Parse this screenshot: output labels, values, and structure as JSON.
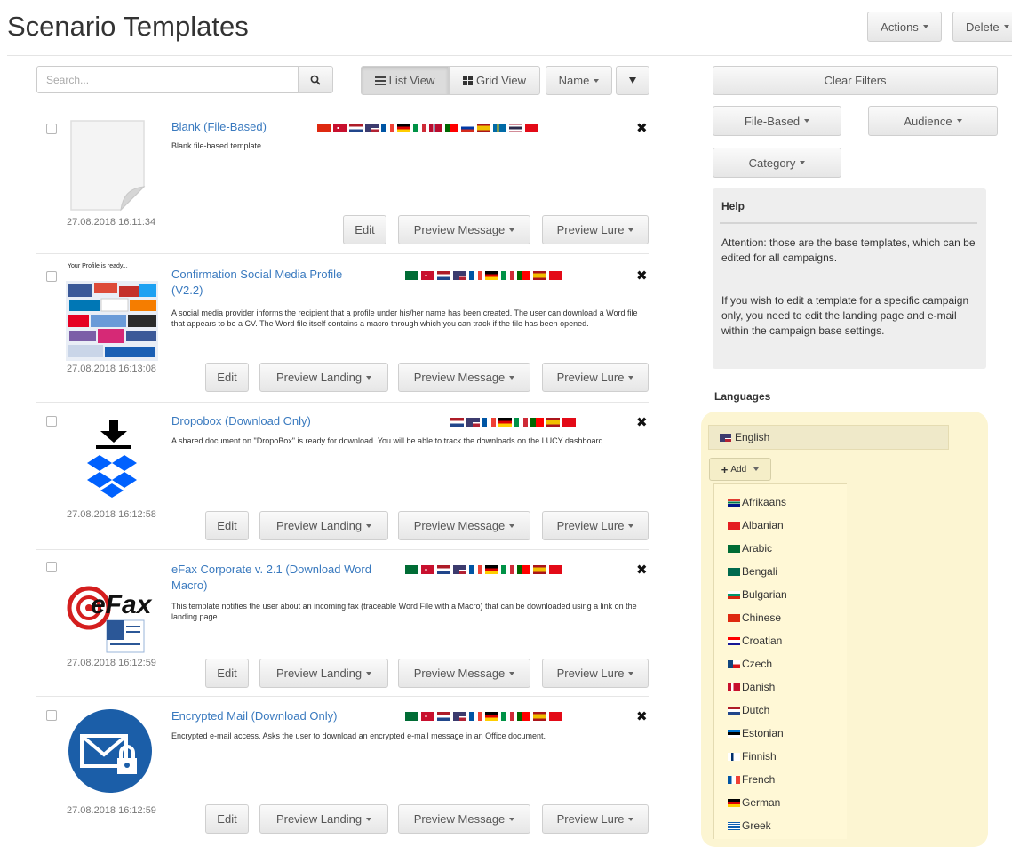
{
  "header": {
    "title": "Scenario Templates",
    "actions_label": "Actions",
    "delete_label": "Delete"
  },
  "toolbar": {
    "search_placeholder": "Search...",
    "list_view_label": "List View",
    "grid_view_label": "Grid View",
    "sort_label": "Name"
  },
  "filters": {
    "clear_label": "Clear Filters",
    "file_based_label": "File-Based",
    "audience_label": "Audience",
    "category_label": "Category"
  },
  "help": {
    "title": "Help",
    "paragraph_1": "Attention: those are the base templates, which can be edited for all campaigns.",
    "paragraph_2": "If you wish to edit a template for a specific campaign only, you need to edit the landing page and e-mail within the campaign base settings."
  },
  "languages": {
    "heading": "Languages",
    "selected": "English",
    "add_label": "Add",
    "options": [
      "Afrikaans",
      "Albanian",
      "Arabic",
      "Bengali",
      "Bulgarian",
      "Chinese",
      "Croatian",
      "Czech",
      "Danish",
      "Dutch",
      "Estonian",
      "Finnish",
      "French",
      "German",
      "Greek"
    ]
  },
  "buttons": {
    "edit": "Edit",
    "preview_landing": "Preview Landing",
    "preview_message": "Preview Message",
    "preview_lure": "Preview Lure"
  },
  "templates": [
    {
      "title": "Blank (File-Based)",
      "description": "Blank file-based template.",
      "date": "27.08.2018 16:11:34",
      "flags": [
        "chinese",
        "danish",
        "dutch",
        "english",
        "french",
        "german",
        "italian",
        "norwegian",
        "portuguese",
        "russian",
        "spanish",
        "swedish",
        "thai",
        "turkish"
      ],
      "thumbnail_text": ""
    },
    {
      "title": "Confirmation Social Media Profile (V2.2)",
      "description": "A social media provider informs the recipient that a profile under his/her name has been created. The user can download a Word file that appears to be a CV. The Word file itself contains a macro through which you can track if the file has been opened.",
      "date": "27.08.2018 16:13:08",
      "flags": [
        "arabic",
        "danish",
        "dutch",
        "english",
        "french",
        "german",
        "italian",
        "portuguese",
        "spanish",
        "turkish"
      ],
      "thumbnail_text": "Your Profile is ready..."
    },
    {
      "title": "Dropobox (Download Only)",
      "description": "A shared document on \"DropoBox\" is ready for download. You will be able to track the downloads on the LUCY dashboard.",
      "date": "27.08.2018 16:12:58",
      "flags": [
        "dutch",
        "english",
        "french",
        "german",
        "italian",
        "portuguese",
        "spanish",
        "turkish"
      ],
      "thumbnail_text": ""
    },
    {
      "title": "eFax Corporate v. 2.1 (Download Word Macro)",
      "description": "This template notifies the user about an incoming fax (traceable Word File with a Macro) that can be downloaded using a link on the landing page.",
      "date": "27.08.2018 16:12:59",
      "flags": [
        "arabic",
        "danish",
        "dutch",
        "english",
        "french",
        "german",
        "italian",
        "portuguese",
        "spanish",
        "turkish"
      ],
      "thumbnail_text": "eFax"
    },
    {
      "title": "Encrypted Mail (Download Only)",
      "description": "Encrypted e-mail access. Asks the user to download an encrypted e-mail message in an Office document.",
      "date": "27.08.2018 16:12:59",
      "flags": [
        "arabic",
        "danish",
        "dutch",
        "english",
        "french",
        "german",
        "italian",
        "portuguese",
        "spanish",
        "turkish"
      ],
      "thumbnail_text": ""
    }
  ],
  "colors": {
    "link": "#3a7abf",
    "languages_panel": "#fcf5d2",
    "help_panel": "#eeeeee"
  },
  "icons": {
    "search": "search-icon",
    "list": "list-icon",
    "grid": "grid-icon",
    "filter": "filter-icon",
    "remove": "close-icon",
    "add": "plus-icon"
  }
}
